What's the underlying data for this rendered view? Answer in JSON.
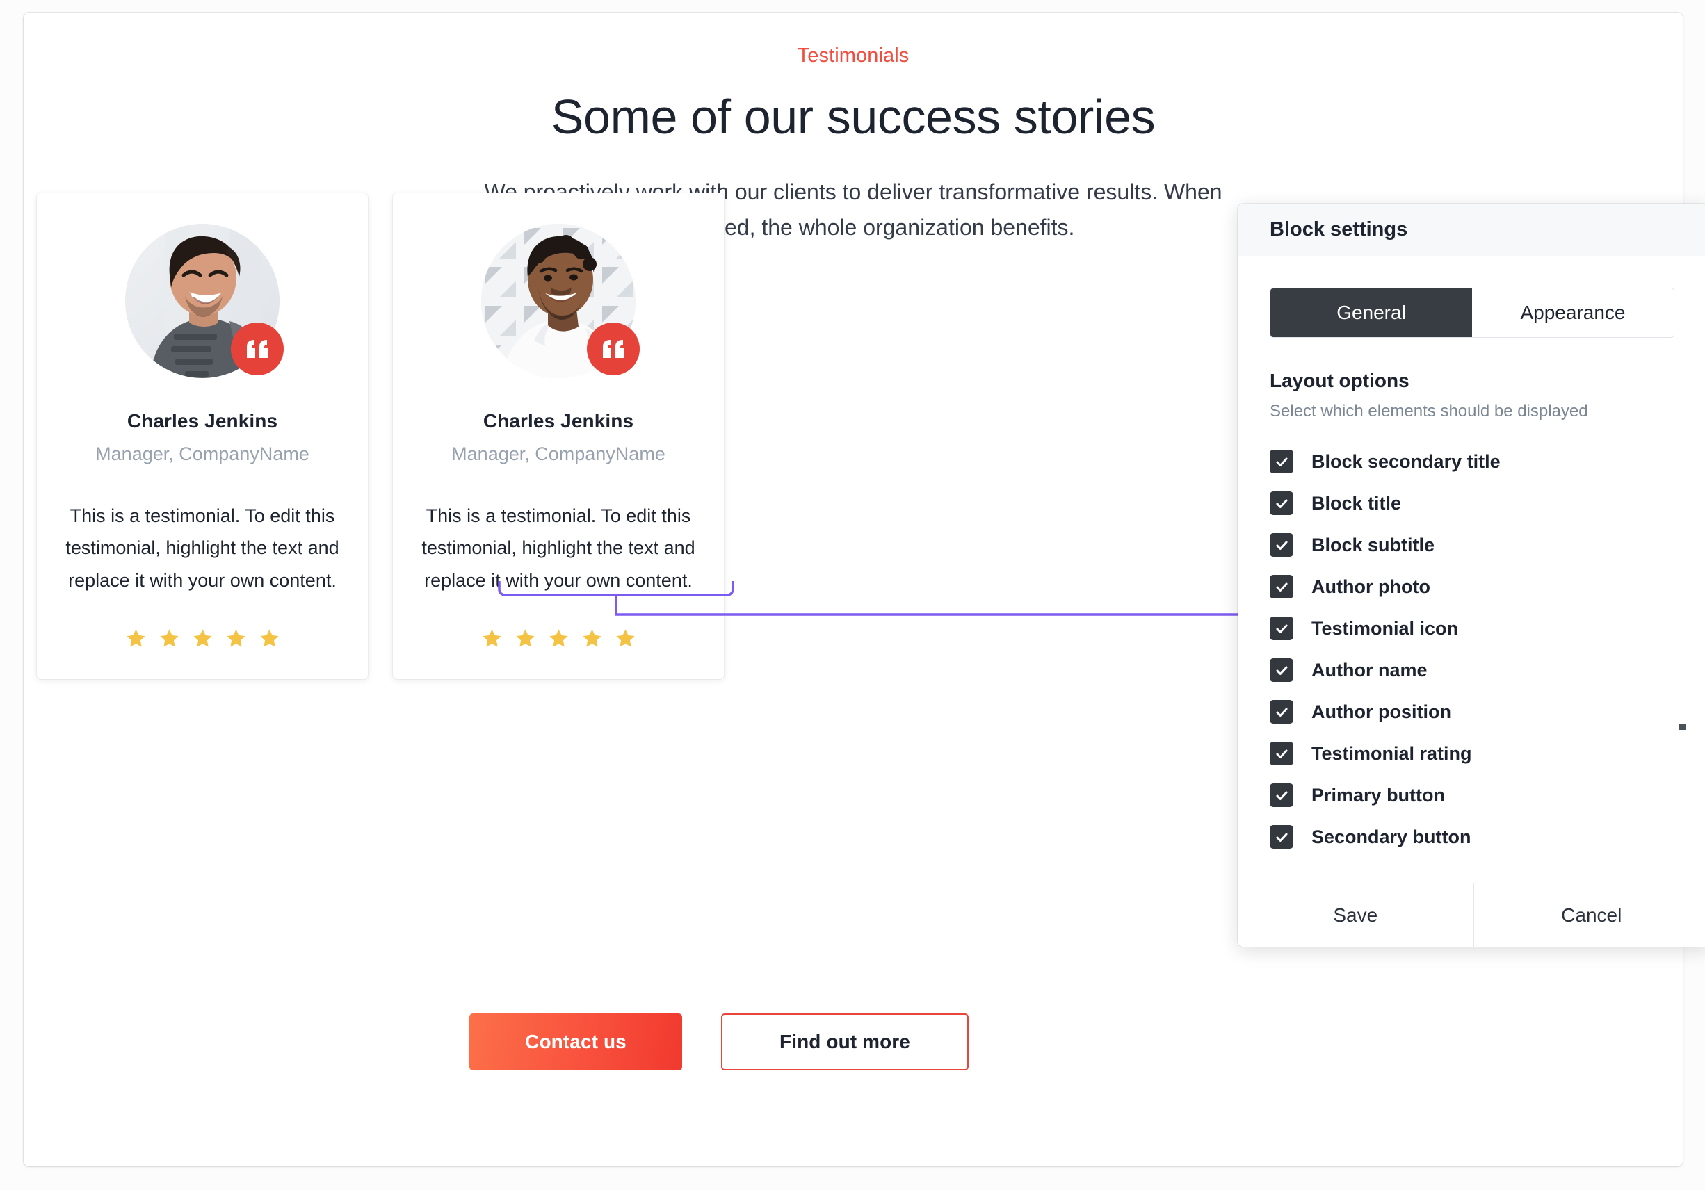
{
  "hero": {
    "eyebrow": "Testimonials",
    "title": "Some of our success stories",
    "subtitle": "We proactively work with our clients to deliver transformative results. When we succeed, the whole organization benefits."
  },
  "testimonials": [
    {
      "author_name": "Charles Jenkins",
      "author_position": "Manager, CompanyName",
      "text": "This is a testimonial. To edit this testimonial, highlight the text and replace it with your own content.",
      "rating": 5,
      "quote_icon": "quote-icon",
      "photo_alt": "laughing-man-photo"
    },
    {
      "author_name": "Charles Jenkins",
      "author_position": "Manager, CompanyName",
      "text": "This is a testimonial. To edit this testimonial, highlight the text and replace it with your own content.",
      "rating": 5,
      "quote_icon": "quote-icon",
      "photo_alt": "smiling-man-photo"
    }
  ],
  "cta": {
    "primary_label": "Contact us",
    "secondary_label": "Find out more"
  },
  "panel": {
    "title": "Block settings",
    "tabs": [
      {
        "label": "General",
        "active": true
      },
      {
        "label": "Appearance",
        "active": false
      }
    ],
    "section": {
      "title": "Layout options",
      "description": "Select which elements should be displayed"
    },
    "options": [
      {
        "label": "Block secondary title",
        "checked": true
      },
      {
        "label": "Block title",
        "checked": true
      },
      {
        "label": "Block subtitle",
        "checked": true
      },
      {
        "label": "Author photo",
        "checked": true
      },
      {
        "label": "Testimonial icon",
        "checked": true
      },
      {
        "label": "Author name",
        "checked": true
      },
      {
        "label": "Author position",
        "checked": true
      },
      {
        "label": "Testimonial rating",
        "checked": true
      },
      {
        "label": "Primary button",
        "checked": true
      },
      {
        "label": "Secondary button",
        "checked": true
      }
    ],
    "footer": {
      "save_label": "Save",
      "cancel_label": "Cancel"
    }
  },
  "colors": {
    "accent_red": "#f04e40",
    "quote_badge": "#e5433a",
    "star": "#f5c344",
    "connector": "#7c5cf0",
    "tab_active_bg": "#383d43",
    "checkbox_bg": "#33383e"
  },
  "connectors": [
    {
      "from": "testimonial-icon-badge",
      "to": "option-testimonial-icon"
    },
    {
      "from": "testimonial-rating-stars",
      "to": "option-testimonial-rating"
    }
  ]
}
